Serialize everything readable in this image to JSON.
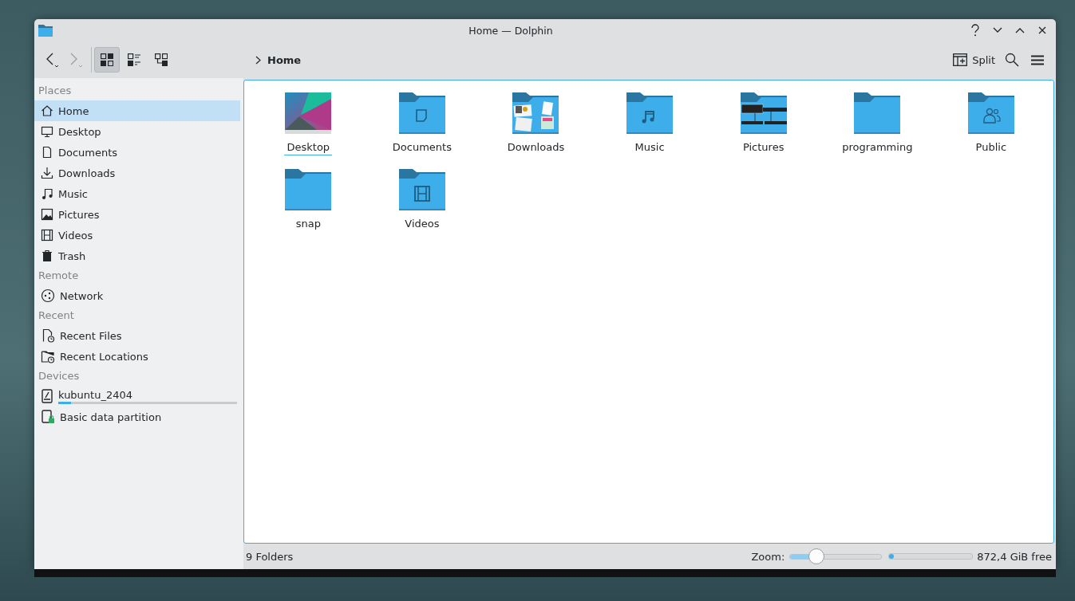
{
  "window": {
    "title": "Home — Dolphin"
  },
  "toolbar": {
    "back": {
      "disabled": false
    },
    "forward": {
      "disabled": true
    },
    "view_modes": [
      {
        "kind": "icons",
        "selected": true
      },
      {
        "kind": "details",
        "selected": false
      },
      {
        "kind": "tree",
        "selected": false
      }
    ],
    "breadcrumb": "Home",
    "split": "Split"
  },
  "sidebar": {
    "sections": [
      {
        "title": "Places",
        "items": [
          {
            "label": "Home",
            "kind": "home",
            "selected": true
          },
          {
            "label": "Desktop",
            "kind": "desktop",
            "selected": false
          },
          {
            "label": "Documents",
            "kind": "document",
            "selected": false
          },
          {
            "label": "Downloads",
            "kind": "download",
            "selected": false
          },
          {
            "label": "Music",
            "kind": "music",
            "selected": false
          },
          {
            "label": "Pictures",
            "kind": "picture",
            "selected": false
          },
          {
            "label": "Videos",
            "kind": "video",
            "selected": false
          },
          {
            "label": "Trash",
            "kind": "trash",
            "selected": false
          }
        ]
      },
      {
        "title": "Remote",
        "items": [
          {
            "label": "Network",
            "kind": "network",
            "selected": false
          }
        ]
      },
      {
        "title": "Recent",
        "items": [
          {
            "label": "Recent Files",
            "kind": "recent-file",
            "selected": false
          },
          {
            "label": "Recent Locations",
            "kind": "recent-folder",
            "selected": false
          }
        ]
      },
      {
        "title": "Devices",
        "items": [
          {
            "label": "kubuntu_2404",
            "kind": "drive",
            "selected": false,
            "level": 0.07
          },
          {
            "label": "Basic data partition",
            "kind": "drive-locked",
            "selected": false
          }
        ]
      }
    ]
  },
  "files": [
    {
      "name": "Desktop",
      "kind": "wallpaper",
      "focused": true
    },
    {
      "name": "Documents",
      "kind": "documents",
      "focused": false
    },
    {
      "name": "Downloads",
      "kind": "downloads",
      "focused": false
    },
    {
      "name": "Music",
      "kind": "music",
      "focused": false
    },
    {
      "name": "Pictures",
      "kind": "pictures",
      "focused": false
    },
    {
      "name": "programming",
      "kind": "plain",
      "focused": false
    },
    {
      "name": "Public",
      "kind": "public",
      "focused": false
    },
    {
      "name": "snap",
      "kind": "plain",
      "focused": false
    },
    {
      "name": "Videos",
      "kind": "videos",
      "focused": false
    }
  ],
  "status_bar": {
    "summary": "9 Folders",
    "zoom_label": "Zoom:",
    "zoom": {
      "level": 0.29
    },
    "space": {
      "level": 0.05
    },
    "free": "872,4 GiB free"
  }
}
